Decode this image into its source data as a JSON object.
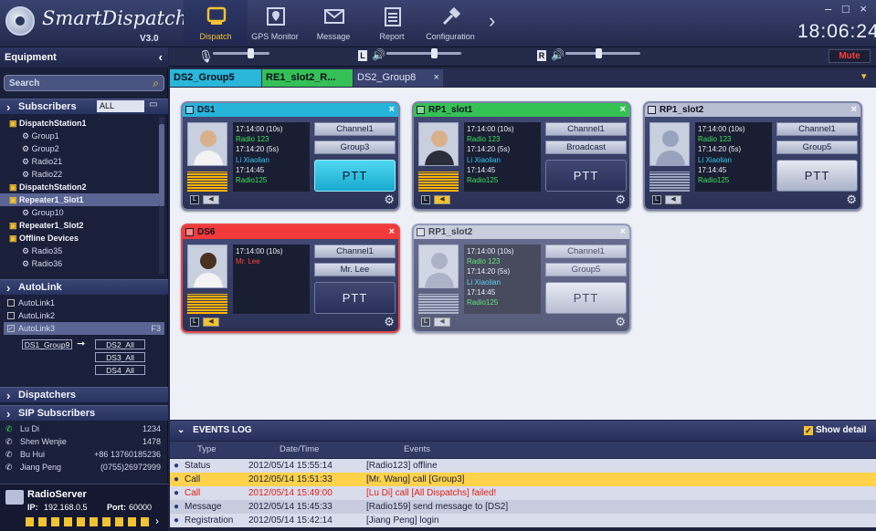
{
  "app": {
    "name": "SmartDispatch",
    "version": "V3.0",
    "clock": "18:06:24"
  },
  "toolbar": [
    {
      "label": "Dispatch",
      "icon": "dispatch-icon"
    },
    {
      "label": "GPS Monitor",
      "icon": "gps-icon"
    },
    {
      "label": "Message",
      "icon": "message-icon"
    },
    {
      "label": "Report",
      "icon": "report-icon"
    },
    {
      "label": "Configuration",
      "icon": "configuration-icon"
    }
  ],
  "volume": {
    "mute_label": "Mute",
    "left_label": "L",
    "right_label": "R"
  },
  "sidebar": {
    "title": "Equipment",
    "search_placeholder": "Search",
    "subscribers_label": "Subscribers",
    "filter_value": "ALL",
    "tree": [
      {
        "label": "DispatchStation1",
        "level": 0
      },
      {
        "label": "Group1",
        "level": 1
      },
      {
        "label": "Group2",
        "level": 1
      },
      {
        "label": "Radio21",
        "level": 1
      },
      {
        "label": "Radio22",
        "level": 1
      },
      {
        "label": "DispatchStation2",
        "level": 0
      },
      {
        "label": "Repeater1_Slot1",
        "level": 0,
        "selected": true
      },
      {
        "label": "Group10",
        "level": 1
      },
      {
        "label": "Repeater1_Slot2",
        "level": 0
      },
      {
        "label": "Offline Devices",
        "level": 0
      },
      {
        "label": "Radio35",
        "level": 1
      },
      {
        "label": "Radio36",
        "level": 1
      }
    ],
    "autolink_label": "AutoLink",
    "autolinks": [
      {
        "label": "AutoLink1",
        "checked": false
      },
      {
        "label": "AutoLink2",
        "checked": false
      },
      {
        "label": "AutoLink3",
        "checked": true,
        "key": "F3"
      }
    ],
    "autolink_source": "DS1_Group9",
    "autolink_targets": [
      "DS2_All",
      "DS3_All",
      "DS4_All"
    ],
    "dispatchers_label": "Dispatchers",
    "sip_label": "SIP Subscribers",
    "sip": [
      {
        "name": "Lu Di",
        "number": "1234"
      },
      {
        "name": "Shen Wenjie",
        "number": "1478"
      },
      {
        "name": "Bu Hui",
        "number": "+86 13760185236"
      },
      {
        "name": "Jiang Peng",
        "number": "(0755)26972999"
      }
    ],
    "server": {
      "name": "RadioServer",
      "ip_label": "IP:",
      "ip": "192.168.0.5",
      "port_label": "Port:",
      "port": "60000"
    }
  },
  "tabs": [
    {
      "label": "DS2_Group5",
      "color": "#29b6d8"
    },
    {
      "label": "RE1_slot2_R...",
      "color": "#35c057"
    },
    {
      "label": "DS2_Group8",
      "color": "#3a4270"
    }
  ],
  "cards": [
    {
      "title": "DS1",
      "header_color": "#27b4da",
      "log": [
        "17:14:00 (10s)",
        "Radio 123",
        "17:14:20 (5s)",
        "Li Xiaolian",
        "17:14:45",
        "Radio125"
      ],
      "channel": "Channel1",
      "target": "Group3",
      "ptt": "PTT"
    },
    {
      "title": "RP1_slot1",
      "header_color": "#36c155",
      "log": [
        "17:14:00 (10s)",
        "Radio 123",
        "17:14:20 (5s)",
        "Li Xiaolian",
        "17:14:45",
        "Radio125"
      ],
      "channel": "Channel1",
      "target": "Broadcast",
      "ptt": "PTT"
    },
    {
      "title": "RP1_slot2",
      "header_color": "#b8bed3",
      "log": [
        "17:14:00 (10s)",
        "Radio 123",
        "17:14:20 (5s)",
        "Li Xiaolian",
        "17:14:45",
        "Radio125"
      ],
      "channel": "Channel1",
      "target": "Group5",
      "ptt": "PTT"
    },
    {
      "title": "DS6",
      "header_color": "#f23a3a",
      "log": [
        "17:14:00 (10s)",
        "Mr. Lee"
      ],
      "channel": "Channel1",
      "target": "Mr. Lee",
      "ptt": "PTT"
    },
    {
      "title": "RP1_slot2",
      "header_color": "#c0c5d6",
      "log": [
        "17:14:00 (10s)",
        "Radio 123",
        "17:14:20 (5s)",
        "Li Xiaolian",
        "17:14:45",
        "Radio125"
      ],
      "channel": "Channel1",
      "target": "Group5",
      "ptt": "PTT"
    }
  ],
  "events": {
    "title": "EVENTS LOG",
    "show_detail": "Show detail",
    "columns": [
      "Type",
      "Date/Time",
      "Events"
    ],
    "rows": [
      {
        "type": "Status",
        "time": "2012/05/14  15:55:14",
        "event": "[Radio123] offline",
        "bg": "#d9dcea"
      },
      {
        "type": "Call",
        "time": "2012/05/14  15:51:33",
        "event": "[Mr. Wang] call [Group3]",
        "bg": "#ffd24a"
      },
      {
        "type": "Call",
        "time": "2012/05/14  15:49:00",
        "event": "[Lu Di] call [All Dispatchs] failed!",
        "bg": "#d9dcea",
        "alert": true
      },
      {
        "type": "Message",
        "time": "2012/05/14  15:45:33",
        "event": "[Radio159] send message to [DS2]",
        "bg": "#c7ccde"
      },
      {
        "type": "Registration",
        "time": "2012/05/14  15:42:14",
        "event": "[Jiang Peng] login",
        "bg": "#d9dcea"
      }
    ]
  }
}
